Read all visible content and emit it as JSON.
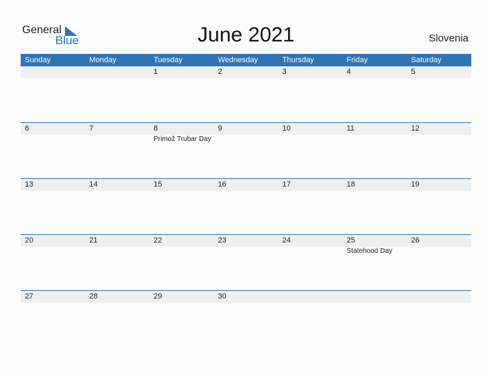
{
  "logo": {
    "general": "General",
    "blue": "Blue"
  },
  "title": "June 2021",
  "country": "Slovenia",
  "weekdays": [
    "Sunday",
    "Monday",
    "Tuesday",
    "Wednesday",
    "Thursday",
    "Friday",
    "Saturday"
  ],
  "weeks": [
    {
      "days": [
        "",
        "",
        "1",
        "2",
        "3",
        "4",
        "5"
      ],
      "holidays": [
        "",
        "",
        "",
        "",
        "",
        "",
        ""
      ]
    },
    {
      "days": [
        "6",
        "7",
        "8",
        "9",
        "10",
        "11",
        "12"
      ],
      "holidays": [
        "",
        "",
        "Primož Trubar Day",
        "",
        "",
        "",
        ""
      ]
    },
    {
      "days": [
        "13",
        "14",
        "15",
        "16",
        "17",
        "18",
        "19"
      ],
      "holidays": [
        "",
        "",
        "",
        "",
        "",
        "",
        ""
      ]
    },
    {
      "days": [
        "20",
        "21",
        "22",
        "23",
        "24",
        "25",
        "26"
      ],
      "holidays": [
        "",
        "",
        "",
        "",
        "",
        "Statehood Day",
        ""
      ]
    },
    {
      "days": [
        "27",
        "28",
        "29",
        "30",
        "",
        "",
        ""
      ],
      "holidays": [
        "",
        "",
        "",
        "",
        "",
        "",
        ""
      ]
    }
  ],
  "colors": {
    "accent": "#2e75b6",
    "strip": "#efefef"
  }
}
